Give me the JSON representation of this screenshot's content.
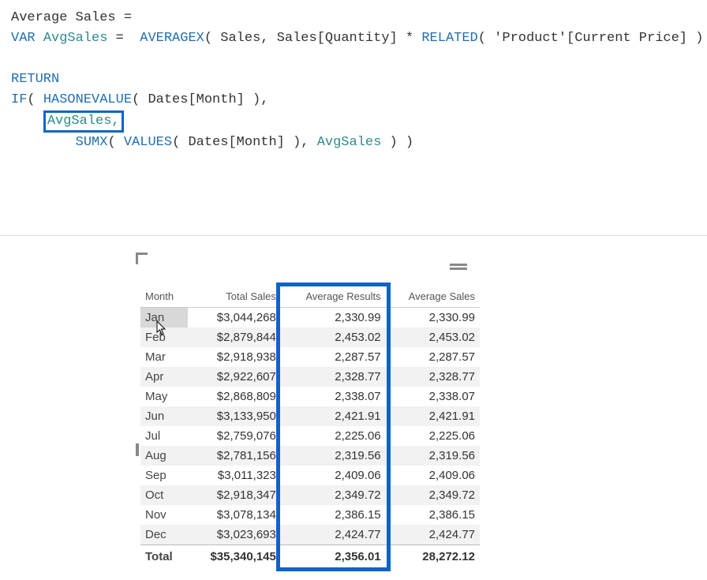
{
  "dax": {
    "measure_name": "Average Sales =",
    "kw_var": "VAR",
    "var_name": "AvgSales",
    "fn_averagex": "AVERAGEX",
    "fn_related": "RELATED",
    "arg_sales": "Sales",
    "arg_salesqty": "Sales[Quantity]",
    "arg_product_price": "'Product'[Current Price]",
    "kw_return": "RETURN",
    "fn_if": "IF",
    "fn_hasonevalue": "HASONEVALUE",
    "arg_dates_month": "Dates[Month]",
    "highlight_token": "AvgSales,",
    "fn_sumx": "SUMX",
    "fn_values": "VALUES",
    "varref_final": "AvgSales"
  },
  "table": {
    "headers": {
      "month": "Month",
      "total_sales": "Total Sales",
      "avg_results": "Average Results",
      "avg_sales": "Average Sales"
    },
    "rows": [
      {
        "month": "Jan",
        "total": "$3,044,268",
        "ar": "2,330.99",
        "as": "2,330.99"
      },
      {
        "month": "Feb",
        "total": "$2,879,844",
        "ar": "2,453.02",
        "as": "2,453.02"
      },
      {
        "month": "Mar",
        "total": "$2,918,938",
        "ar": "2,287.57",
        "as": "2,287.57"
      },
      {
        "month": "Apr",
        "total": "$2,922,607",
        "ar": "2,328.77",
        "as": "2,328.77"
      },
      {
        "month": "May",
        "total": "$2,868,809",
        "ar": "2,338.07",
        "as": "2,338.07"
      },
      {
        "month": "Jun",
        "total": "$3,133,950",
        "ar": "2,421.91",
        "as": "2,421.91"
      },
      {
        "month": "Jul",
        "total": "$2,759,076",
        "ar": "2,225.06",
        "as": "2,225.06"
      },
      {
        "month": "Aug",
        "total": "$2,781,156",
        "ar": "2,319.56",
        "as": "2,319.56"
      },
      {
        "month": "Sep",
        "total": "$3,011,323",
        "ar": "2,409.06",
        "as": "2,409.06"
      },
      {
        "month": "Oct",
        "total": "$2,918,347",
        "ar": "2,349.72",
        "as": "2,349.72"
      },
      {
        "month": "Nov",
        "total": "$3,078,134",
        "ar": "2,386.15",
        "as": "2,386.15"
      },
      {
        "month": "Dec",
        "total": "$3,023,693",
        "ar": "2,424.77",
        "as": "2,424.77"
      }
    ],
    "total": {
      "label": "Total",
      "total": "$35,340,145",
      "ar": "2,356.01",
      "as": "28,272.12"
    }
  }
}
